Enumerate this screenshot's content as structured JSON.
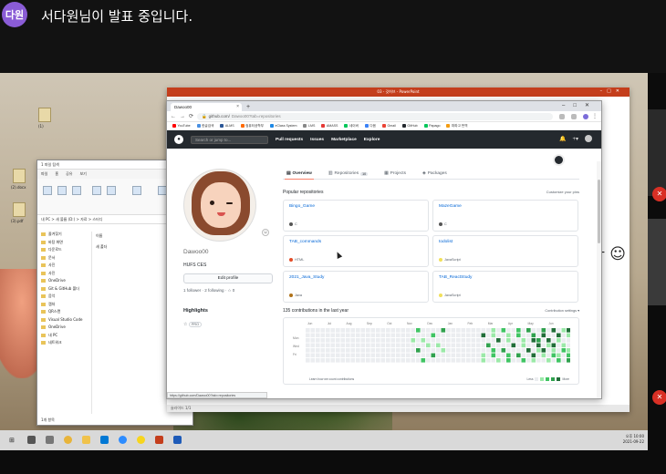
{
  "meeting": {
    "presenter_initials": "다원",
    "presenting_text": "서다원님이 발표 중입니다.",
    "accent": "#8a5cd6"
  },
  "desktop": {
    "icons": [
      "(1)",
      "(2).docx",
      "(3).pdf"
    ],
    "explorer": {
      "title": "1 파일 탐색",
      "tabs": [
        "파일",
        "홈",
        "공유",
        "보기"
      ],
      "address": "내 PC > 새 볼륨 (D:) > 자료 > 스터디",
      "search_label": "이 PC",
      "nav_items": [
        "즐겨찾기",
        "바탕 화면",
        "다운로드",
        "문서",
        "사진",
        "사진",
        "OneDrive",
        "Git & GitHub 폴더",
        "음악",
        "캡처",
        "QR스캔",
        "Visual Studio Code",
        "OneDrive",
        "내 PC",
        "네트워크"
      ],
      "content_items": [
        "이름",
        "새 폴더"
      ],
      "status": "1개 항목"
    },
    "ppt": {
      "title": "03 - 깃허브 - PowerPoint",
      "slide_fragment": "다 ☺",
      "status": "슬라이드 1/1"
    }
  },
  "browser": {
    "tab_title": "Dawoo00",
    "url_secure": "github.com/",
    "url_path": "Dawoo00?tab=repositories",
    "bookmarks": [
      "YouTube",
      "한글검색",
      "ALMS",
      "컴퓨터공학부",
      "eClass System",
      "LMS",
      "AMASS",
      "네이버",
      "다음",
      "Gmail",
      "GitHub",
      "Papago",
      "파파고 번역"
    ],
    "status_url": "https://github.com/Dawoo00?tab=repositories"
  },
  "github": {
    "search_placeholder": "Search or jump to...",
    "nav": [
      "Pull requests",
      "Issues",
      "Marketplace",
      "Explore"
    ],
    "profile": {
      "username": "Dawoo00",
      "bio": "HUFS CES",
      "edit_label": "Edit profile",
      "follow_text": "1 follower · 2 following · ☆ 0",
      "highlights_title": "Highlights",
      "highlight_badge": "PRO"
    },
    "tabs": [
      {
        "label": "Overview",
        "active": true
      },
      {
        "label": "Repositories",
        "count": "10",
        "active": false
      },
      {
        "label": "Projects",
        "active": false
      },
      {
        "label": "Packages",
        "active": false
      }
    ],
    "popular_title": "Popular repositories",
    "customize_label": "Customize your pins",
    "repos": [
      {
        "name": "Bingo_Game",
        "lang": "C",
        "color": "#555555"
      },
      {
        "name": "MazeGame",
        "lang": "C",
        "color": "#555555"
      },
      {
        "name": "TAB_commands",
        "lang": "HTML",
        "color": "#e34c26"
      },
      {
        "name": "todolist",
        "lang": "JavaScript",
        "color": "#f1e05a"
      },
      {
        "name": "2021_Java_Study",
        "lang": "Java",
        "color": "#b07219"
      },
      {
        "name": "TAB_ReactStudy",
        "lang": "JavaScript",
        "color": "#f1e05a"
      }
    ],
    "contrib_title": "135 contributions in the last year",
    "contrib_settings": "Contribution settings ▾",
    "months": [
      "Jun",
      "Jul",
      "Aug",
      "Sep",
      "Oct",
      "Nov",
      "Dec",
      "Jan",
      "Feb",
      "Mar",
      "Apr",
      "May",
      "Jun"
    ],
    "days": [
      "Mon",
      "Wed",
      "Fri"
    ],
    "contrib_foot": "Learn how we count contributions",
    "legend_less": "Less",
    "legend_more": "More",
    "green": [
      "#ebedf0",
      "#9be9a8",
      "#40c463",
      "#30a14e",
      "#216e39"
    ]
  },
  "taskbar": {
    "time": "오후 10:00",
    "date": "2021-09-22"
  }
}
